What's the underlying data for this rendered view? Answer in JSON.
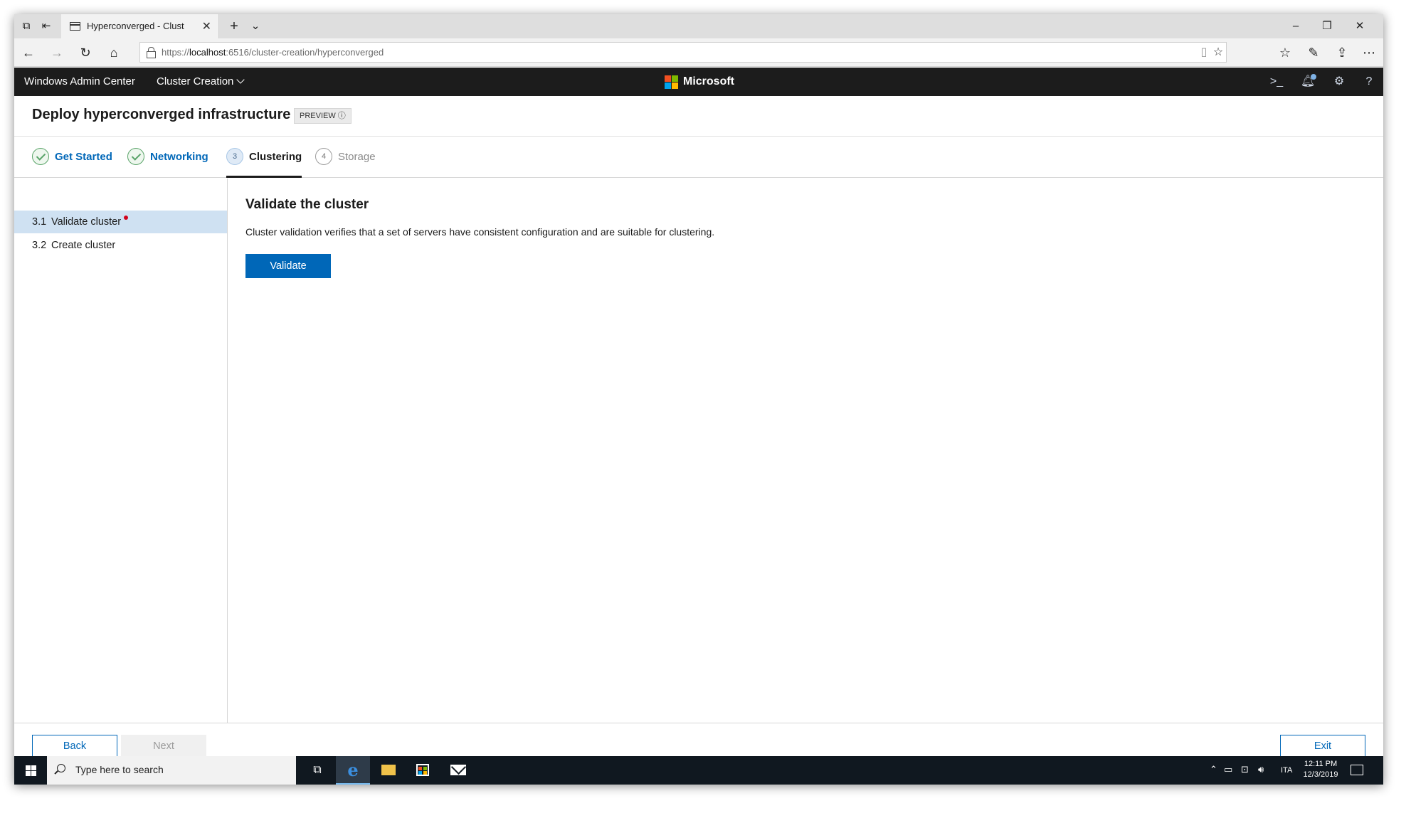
{
  "browser": {
    "tab_title": "Hyperconverged - Clust",
    "url_prefix": "https://",
    "url_host": "localhost",
    "url_rest": ":6516/cluster-creation/hyperconverged",
    "icons": [
      "tab-actions-icon",
      "tab-aside-icon",
      "new-tab-icon",
      "tab-dropdown-icon",
      "back-icon",
      "forward-icon",
      "refresh-icon",
      "home-icon",
      "lock-icon",
      "reading-view-icon",
      "favorite-star-icon",
      "favorites-hub-icon",
      "pen-icon",
      "share-icon",
      "more-icon",
      "minimize-icon",
      "restore-icon",
      "close-icon"
    ]
  },
  "app": {
    "name": "Windows Admin Center",
    "menu_label": "Cluster Creation",
    "brand": "Microsoft",
    "brand_colors": [
      "#f25022",
      "#7fba00",
      "#00a4ef",
      "#ffb900"
    ],
    "header_icons": [
      "powershell-icon",
      "notifications-icon",
      "settings-icon",
      "help-icon"
    ]
  },
  "page": {
    "title": "Deploy hyperconverged infrastructure",
    "badge": "PREVIEW ⓘ"
  },
  "steps": [
    {
      "number": "1",
      "label": "Get Started",
      "state": "done"
    },
    {
      "number": "2",
      "label": "Networking",
      "state": "done"
    },
    {
      "number": "3",
      "label": "Clustering",
      "state": "current"
    },
    {
      "number": "4",
      "label": "Storage",
      "state": "todo"
    }
  ],
  "sidebar": {
    "items": [
      {
        "number": "3.1",
        "label": "Validate cluster",
        "active": true,
        "required": true
      },
      {
        "number": "3.2",
        "label": "Create cluster",
        "active": false,
        "required": false
      }
    ]
  },
  "content": {
    "title": "Validate the cluster",
    "description": "Cluster validation verifies that a set of servers have consistent configuration and are suitable for clustering.",
    "validate_label": "Validate"
  },
  "footer": {
    "back_label": "Back",
    "next_label": "Next",
    "exit_label": "Exit"
  },
  "taskbar": {
    "search_placeholder": "Type here to search",
    "language": "ITA",
    "time": "12:11 PM",
    "date": "12/3/2019"
  },
  "colors": {
    "accent": "#0067b8",
    "app_bar": "#1c1c1c",
    "step_done": "#5aa469",
    "sidebar_active": "#cfe1f2",
    "required_dot": "#d0021b",
    "taskbar": "#101820"
  }
}
